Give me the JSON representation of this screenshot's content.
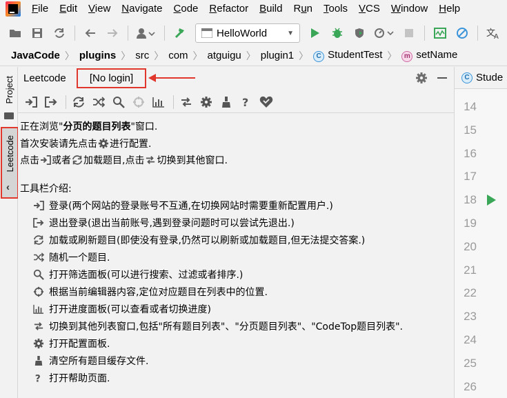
{
  "menu": [
    "File",
    "Edit",
    "View",
    "Navigate",
    "Code",
    "Refactor",
    "Build",
    "Run",
    "Tools",
    "VCS",
    "Window",
    "Help"
  ],
  "menu_mnemonic_index": [
    0,
    0,
    0,
    0,
    0,
    0,
    0,
    1,
    0,
    0,
    0,
    0
  ],
  "toolbar": {
    "run_config": "HelloWorld"
  },
  "breadcrumb": [
    "JavaCode",
    "plugins",
    "src",
    "com",
    "atguigu",
    "plugin1",
    "StudentTest",
    "setName"
  ],
  "left_strip": {
    "project": "Project",
    "leetcode": "Leetcode"
  },
  "panel": {
    "title": "Leetcode",
    "login_status": "[No login]"
  },
  "content": {
    "line1_pre": "正在浏览\"",
    "line1_bold": "分页的题目列表",
    "line1_post": "\"窗口.",
    "line2_pre": "首次安装请先点击",
    "line2_post": "进行配置.",
    "line3_a": "点击",
    "line3_b": "或者",
    "line3_c": "加载题目,点击",
    "line3_d": "切换到其他窗口.",
    "intro_title": "工具栏介绍:",
    "items": [
      {
        "icon": "login-icon",
        "text": "登录(两个网站的登录账号不互通,在切换网站时需要重新配置用户.)"
      },
      {
        "icon": "logout-icon",
        "text": "退出登录(退出当前账号,遇到登录问题时可以尝试先退出.)"
      },
      {
        "icon": "refresh-icon",
        "text": "加载或刷新题目(即使没有登录,仍然可以刷新或加载题目,但无法提交答案.)"
      },
      {
        "icon": "shuffle-icon",
        "text": "随机一个题目."
      },
      {
        "icon": "search-icon",
        "text": "打开筛选面板(可以进行搜索、过滤或者排序.)"
      },
      {
        "icon": "locate-icon",
        "text": "根据当前编辑器内容,定位对应题目在列表中的位置."
      },
      {
        "icon": "progress-icon",
        "text": "打开进度面板(可以查看或者切换进度)"
      },
      {
        "icon": "switch-icon",
        "text": "切换到其他列表窗口,包括\"所有题目列表\"、\"分页题目列表\"、\"CodeTop题目列表\"."
      },
      {
        "icon": "gear-icon",
        "text": "打开配置面板."
      },
      {
        "icon": "clear-icon",
        "text": "清空所有题目缓存文件."
      },
      {
        "icon": "help-icon",
        "text": "打开帮助页面."
      }
    ]
  },
  "editor": {
    "tab_label": "Stude",
    "line_numbers": [
      "14",
      "15",
      "16",
      "17",
      "18",
      "19",
      "20",
      "21",
      "22",
      "23",
      "24",
      "25",
      "26"
    ]
  },
  "colors": {
    "highlight_red": "#e0362c",
    "run_green": "#3aa657",
    "icon_gray": "#6e6e6e"
  }
}
